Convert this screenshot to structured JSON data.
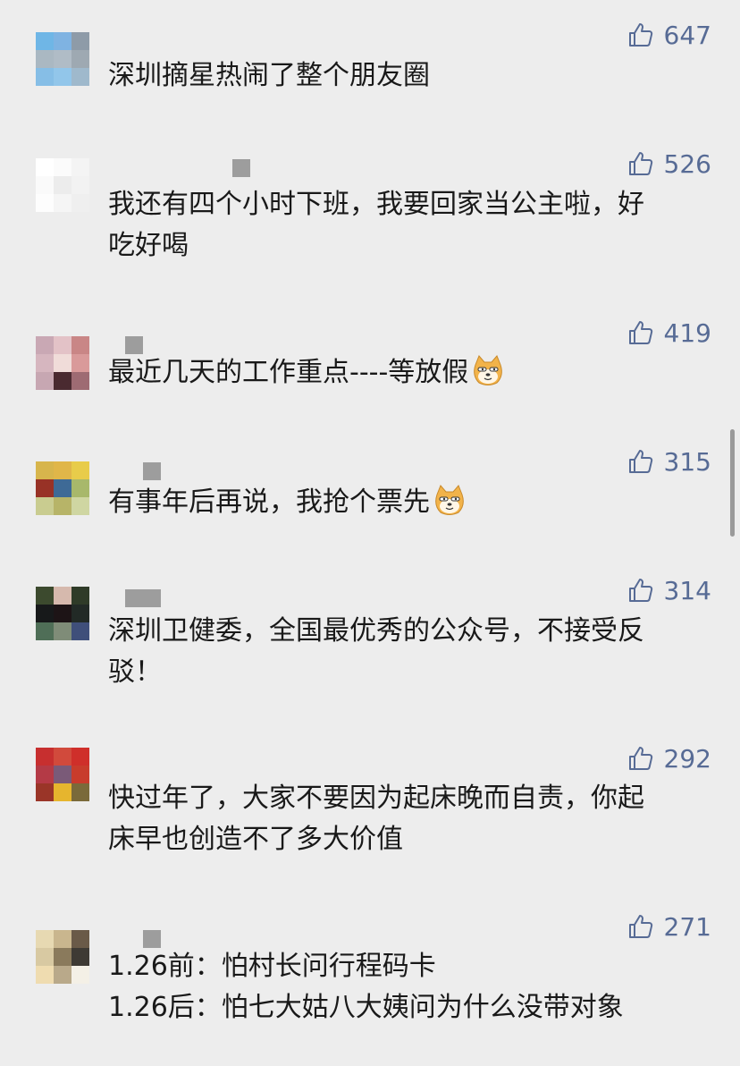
{
  "colors": {
    "background": "#ededed",
    "like_accent": "#576b95",
    "text": "#191919"
  },
  "comments": [
    {
      "likes": "647",
      "text": "深圳摘星热闹了整个朋友圈",
      "avatar": [
        "#6fb6e6",
        "#7fb3e2",
        "#8e9ba8",
        "#aab8c2",
        "#b0bcc6",
        "#9ea9b2",
        "#86bee6",
        "#92c6ea",
        "#9fb9cc"
      ]
    },
    {
      "likes": "526",
      "text": "我还有四个小时下班，我要回家当公主啦，好\n吃好喝",
      "avatar": [
        "#ffffff",
        "#fbfbfb",
        "#f4f4f4",
        "#fafafa",
        "#ececec",
        "#f2f2f2",
        "#fdfdfd",
        "#f5f5f5",
        "#efefef"
      ]
    },
    {
      "likes": "419",
      "text": "最近几天的工作重点----等放假",
      "avatar": [
        "#c9a8b4",
        "#e3c2c7",
        "#c98686",
        "#d6b6bf",
        "#f0dcd9",
        "#d99a9a",
        "#c7a7b2",
        "#4a2a30",
        "#9e6b73"
      ]
    },
    {
      "likes": "315",
      "text": "有事年后再说，我抢个票先",
      "avatar": [
        "#d7b54c",
        "#e0b649",
        "#e8cc4a",
        "#983226",
        "#3e6a96",
        "#a8b86b",
        "#c9cc90",
        "#b7b468",
        "#cfd6a2"
      ]
    },
    {
      "likes": "314",
      "text": "深圳卫健委，全国最优秀的公众号，不接受反\n驳！",
      "avatar": [
        "#3c4a2e",
        "#d6b9ad",
        "#2f3b28",
        "#17191a",
        "#1d1416",
        "#222a26",
        "#4f6e57",
        "#7f8c78",
        "#3f4f7a"
      ]
    },
    {
      "likes": "292",
      "text": "快过年了，大家不要因为起床晚而自责，你起\n床早也创造不了多大价值",
      "avatar": [
        "#c72f2f",
        "#d14a3c",
        "#cf2f2a",
        "#b43a46",
        "#7a5a78",
        "#c83c2c",
        "#9a3528",
        "#e6b52e",
        "#7a6a3a"
      ]
    },
    {
      "likes": "271",
      "text": "1.26前：怕村长问行程码卡\n1.26后：怕七大姑八大姨问为什么没带对象",
      "avatar": [
        "#e7d9b2",
        "#c9b68e",
        "#6a5a48",
        "#d8c9a2",
        "#8a7a5c",
        "#3e3a34",
        "#efdcb0",
        "#b9a98a",
        "#f4f0e6"
      ]
    }
  ]
}
